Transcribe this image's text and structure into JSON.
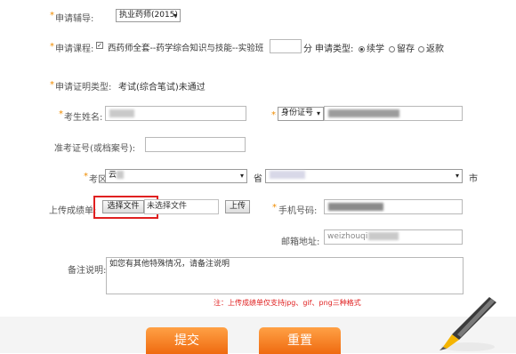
{
  "apply_tutor": {
    "label": "申请辅导:",
    "value": "执业药师(2015)"
  },
  "apply_course": {
    "label": "申请课程:",
    "course_name": "西药师全套--药学综合知识与技能--实验班",
    "score_unit": "分",
    "type_label": "申请类型:",
    "types": [
      "续学",
      "留存",
      "返款"
    ],
    "selected_type": "续学"
  },
  "proof_type": {
    "label": "申请证明类型:",
    "value": "考试(综合笔试)未通过"
  },
  "candidate_name": {
    "label": "考生姓名:"
  },
  "id_type": {
    "value": "身份证号"
  },
  "exam_number": {
    "label": "准考证号(或档案号):"
  },
  "exam_area": {
    "label": "考区:",
    "province_value": "云",
    "province_suffix": "省",
    "city_value": "市",
    "city_suffix": "市"
  },
  "upload": {
    "label": "上传成绩单:",
    "choose_button": "选择文件",
    "no_file": "未选择文件",
    "upload_button": "上传"
  },
  "phone": {
    "label": "手机号码:"
  },
  "email": {
    "label": "邮箱地址:",
    "value": "weizhouqi"
  },
  "remarks": {
    "label": "备注说明:",
    "placeholder": "如您有其他特殊情况，请备注说明"
  },
  "note": "注：上传成绩单仅支持jpg、gif、png三种格式",
  "actions": {
    "submit": "提交",
    "reset": "重置"
  },
  "colors": {
    "accent": "#f08c00",
    "button": "#ef6a10",
    "note": "#e02020",
    "highlight": "#e02020"
  }
}
